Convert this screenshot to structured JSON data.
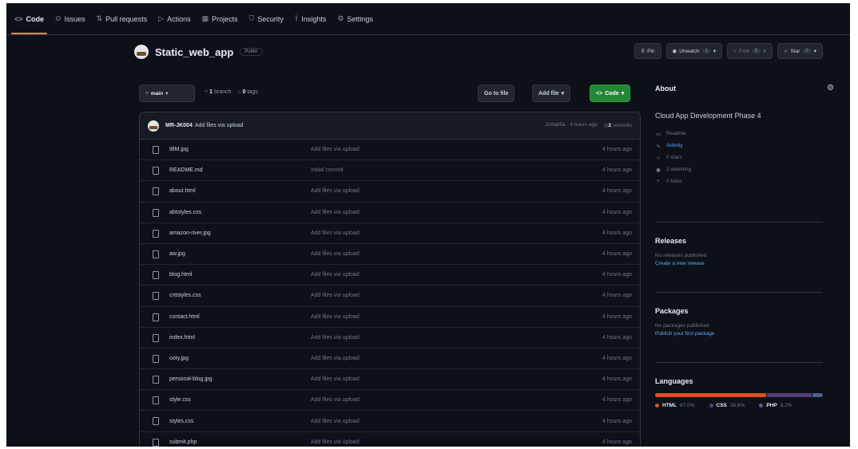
{
  "nav": {
    "tabs": [
      {
        "icon": "<>",
        "label": "Code",
        "active": true
      },
      {
        "icon": "⊙",
        "label": "Issues"
      },
      {
        "icon": "⇅",
        "label": "Pull requests"
      },
      {
        "icon": "▷",
        "label": "Actions"
      },
      {
        "icon": "▦",
        "label": "Projects"
      },
      {
        "icon": "⛉",
        "label": "Security"
      },
      {
        "icon": "⌇",
        "label": "Insights"
      },
      {
        "icon": "⚙",
        "label": "Settings"
      }
    ]
  },
  "repo": {
    "name": "Static_web_app",
    "visibility": "Public",
    "pin": "Pin",
    "unwatch": "Unwatch",
    "unwatch_count": "1",
    "fork": "Fork",
    "fork_count": "0",
    "star": "Star",
    "star_count": "0"
  },
  "toolbar": {
    "branch": "main",
    "branches_count": "1",
    "branches_label": "branch",
    "tags_count": "0",
    "tags_label": "tags",
    "go_to_file": "Go to file",
    "add_file": "Add file",
    "code": "Code"
  },
  "commit": {
    "author": "MR-JK004",
    "message": "Add files via upload",
    "sha": "1b9ab5a",
    "time": "4 hours ago",
    "commits_count": "2",
    "commits_label": "commits"
  },
  "files": [
    {
      "name": "IBM.jpg",
      "commit": "Add files via upload",
      "time": "4 hours ago"
    },
    {
      "name": "README.md",
      "commit": "Initial commit",
      "time": "4 hours ago"
    },
    {
      "name": "about.html",
      "commit": "Add files via upload",
      "time": "4 hours ago"
    },
    {
      "name": "abtstyles.css",
      "commit": "Add files via upload",
      "time": "4 hours ago"
    },
    {
      "name": "amazon-river.jpg",
      "commit": "Add files via upload",
      "time": "4 hours ago"
    },
    {
      "name": "aw.jpg",
      "commit": "Add files via upload",
      "time": "4 hours ago"
    },
    {
      "name": "blog.html",
      "commit": "Add files via upload",
      "time": "4 hours ago"
    },
    {
      "name": "cntstyles.css",
      "commit": "Add files via upload",
      "time": "4 hours ago"
    },
    {
      "name": "contact.html",
      "commit": "Add files via upload",
      "time": "4 hours ago"
    },
    {
      "name": "index.html",
      "commit": "Add files via upload",
      "time": "4 hours ago"
    },
    {
      "name": "ooty.jpg",
      "commit": "Add files via upload",
      "time": "4 hours ago"
    },
    {
      "name": "personal-blog.jpg",
      "commit": "Add files via upload",
      "time": "4 hours ago"
    },
    {
      "name": "style.css",
      "commit": "Add files via upload",
      "time": "4 hours ago"
    },
    {
      "name": "styles.css",
      "commit": "Add files via upload",
      "time": "4 hours ago"
    },
    {
      "name": "submit.php",
      "commit": "Add files via upload",
      "time": "4 hours ago"
    }
  ],
  "about": {
    "title": "About",
    "description": "Cloud App Development Phase 4",
    "readme": "Readme",
    "activity": "Activity",
    "stars": "0 stars",
    "watching": "1 watching",
    "forks": "0 forks"
  },
  "releases": {
    "title": "Releases",
    "text": "No releases published",
    "link": "Create a new release"
  },
  "packages": {
    "title": "Packages",
    "text": "No packages published",
    "link": "Publish your first package"
  },
  "languages": {
    "title": "Languages",
    "items": [
      {
        "name": "HTML",
        "pct": "67.0%",
        "value": 67.0,
        "color": "#e34c26"
      },
      {
        "name": "CSS",
        "pct": "26.8%",
        "value": 26.8,
        "color": "#563d7c"
      },
      {
        "name": "PHP",
        "pct": "6.2%",
        "value": 6.2,
        "color": "#4f5d95"
      }
    ]
  }
}
